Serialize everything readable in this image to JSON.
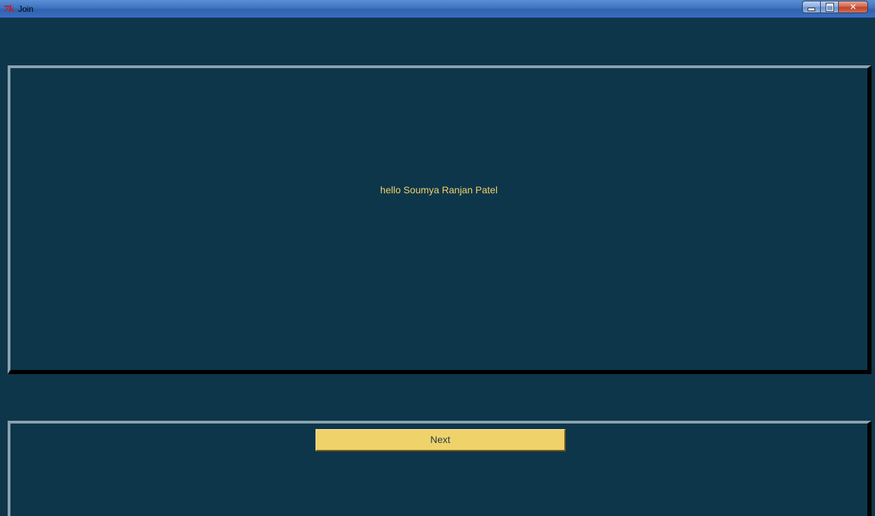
{
  "window": {
    "title": "Join",
    "app_icon_text": "7k"
  },
  "main": {
    "greeting": "hello Soumya Ranjan Patel"
  },
  "footer": {
    "next_label": "Next"
  },
  "colors": {
    "background": "#0e364b",
    "accent_text": "#f0d26a",
    "button_bg": "#f0d26a"
  }
}
